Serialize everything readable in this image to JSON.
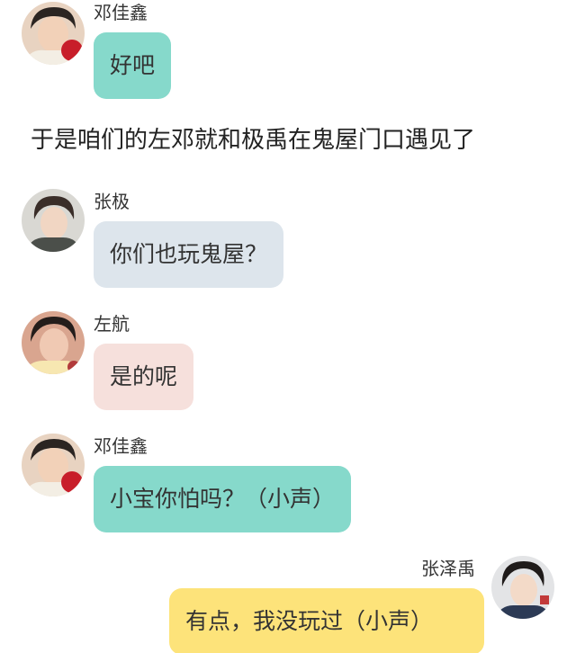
{
  "colors": {
    "bubble_teal": "#86d9cb",
    "bubble_grey": "#dde5ec",
    "bubble_pink": "#f6e0dc",
    "bubble_yellow": "#fde37a"
  },
  "messages": [
    {
      "sender": "邓佳鑫",
      "text": "好吧",
      "bubble_color": "teal",
      "side": "left"
    },
    {
      "sender": "张极",
      "text": "你们也玩鬼屋？",
      "bubble_color": "grey",
      "side": "left"
    },
    {
      "sender": "左航",
      "text": "是的呢",
      "bubble_color": "pink",
      "side": "left"
    },
    {
      "sender": "邓佳鑫",
      "text": "小宝你怕吗？（小声）",
      "bubble_color": "teal",
      "side": "left"
    },
    {
      "sender": "张泽禹",
      "text": "有点，我没玩过（小声）",
      "bubble_color": "yellow",
      "side": "right"
    }
  ],
  "narration": "于是咱们的左邓就和极禹在鬼屋门口遇见了"
}
